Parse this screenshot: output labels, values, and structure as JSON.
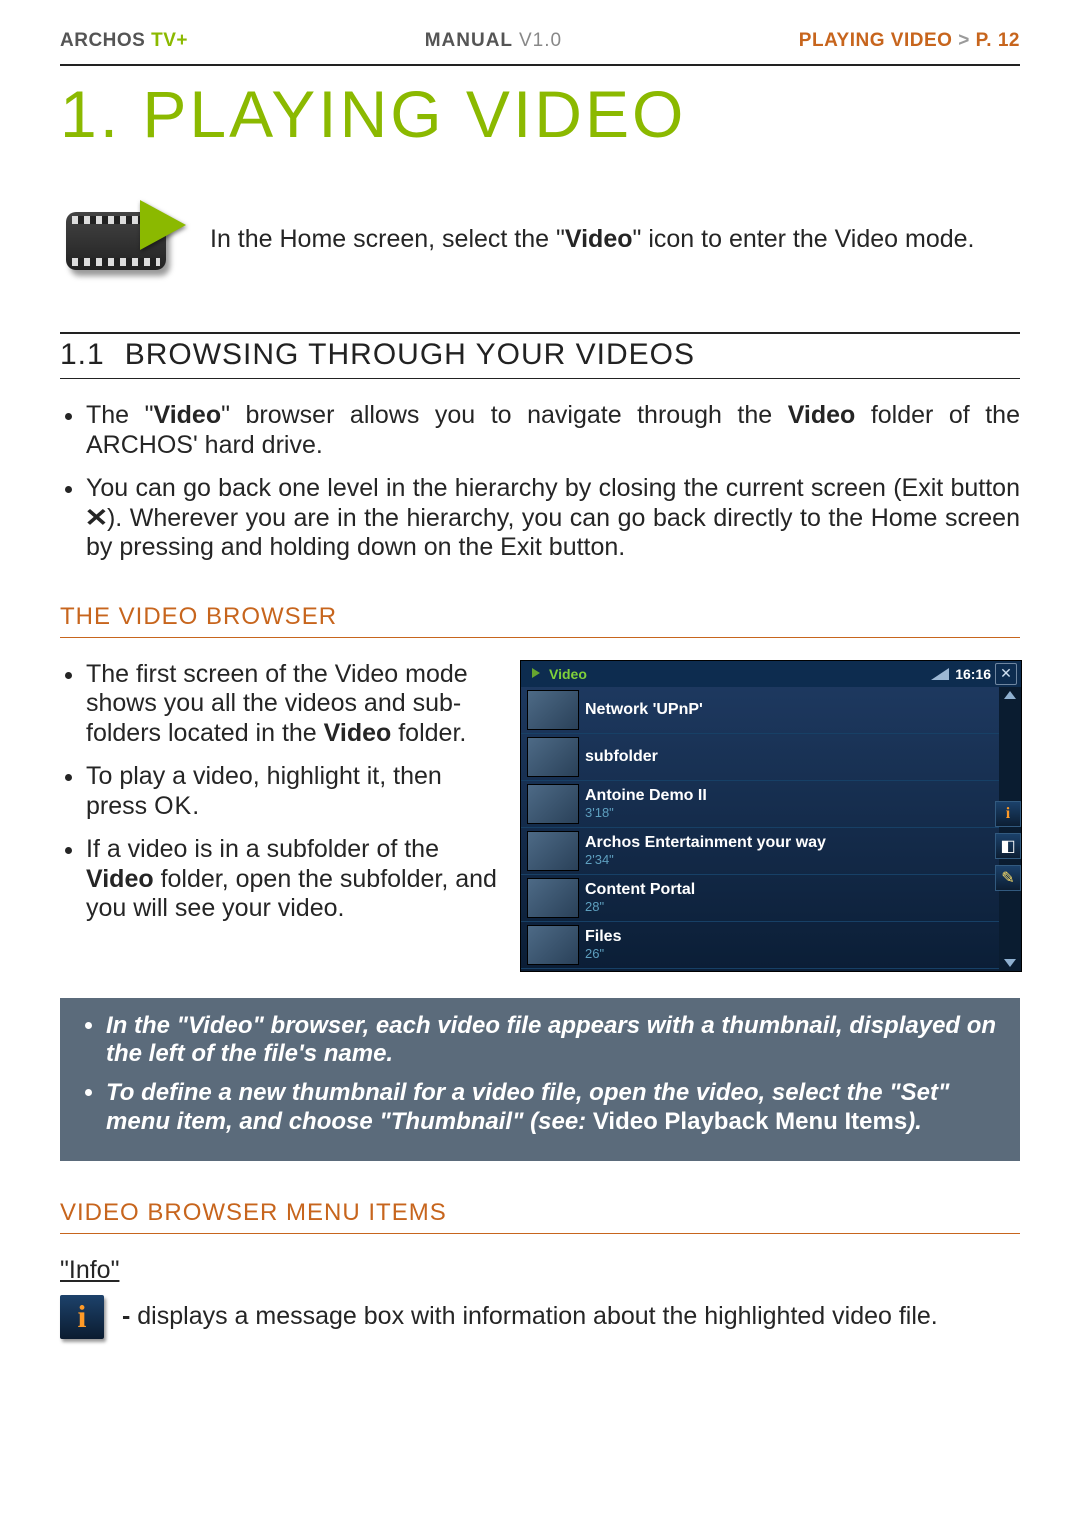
{
  "header": {
    "brand_pre": "ARCHOS ",
    "brand_suf": "TV+",
    "manual": "MANUAL ",
    "version": "V1.0",
    "bc_section": "PLAYING VIDEO",
    "bc_gt": "   >   ",
    "bc_page": "P. 12"
  },
  "title": "1. PLAYING VIDEO",
  "intro_pre": "In the Home screen, select the \"",
  "intro_bold": "Video",
  "intro_post": "\" icon to enter the Video mode.",
  "sec11_num": "1.1",
  "sec11_title": "BROWSING THROUGH YOUR VIDEOS",
  "l11a_pre": "The \"",
  "l11a_b1": "Video",
  "l11a_mid": "\" browser allows you to navigate through the ",
  "l11a_b2": "Video",
  "l11a_post": " folder of the ARCHOS' hard drive.",
  "l11b_pre": "You can go back one level in the hierarchy by closing the current screen (Exit but­ton ",
  "l11b_x": "✕",
  "l11b_post": "). Wherever you are in the hierarchy, you can go back directly to the Home screen by pressing and holding down on the Exit button.",
  "h_video_browser": "THE VIDEO BROWSER",
  "vb1_pre": "The first screen of the Video mode shows you all the videos and sub­folders located in the ",
  "vb1_b": "Video",
  "vb1_post": " folder.",
  "vb2_pre": "To play a video, highlight it, then press ",
  "vb2_ok": "OK",
  "vb2_post": ".",
  "vb3_pre": "If a video is in a subfolder of the ",
  "vb3_b": "Video",
  "vb3_mid": " folder, open the subfolder, and you will see your video.",
  "browser": {
    "title": "Video",
    "time": "16:16",
    "rows": [
      {
        "name": "Network 'UPnP'",
        "dur": ""
      },
      {
        "name": "subfolder",
        "dur": ""
      },
      {
        "name": "Antoine Demo II",
        "dur": "3'18\""
      },
      {
        "name": "Archos Entertainment your way",
        "dur": "2'34\""
      },
      {
        "name": "Content Portal",
        "dur": "28\""
      },
      {
        "name": "Files",
        "dur": "26\""
      }
    ]
  },
  "tip1": "In the \"Video\" browser, each video file appears with a thumbnail, displayed on the left of the file's name.",
  "tip2_pre": "To define a new thumbnail for a video file, open the video, select the \"Set\" menu item, and choose \"Thumbnail\" (see: ",
  "tip2_link": "Video Playback Menu Items",
  "tip2_post": ").",
  "h_menu_items": "VIDEO BROWSER MENU ITEMS",
  "info_title": "\"Info\"",
  "info_desc": "displays a message box with information about the highlighted video file."
}
